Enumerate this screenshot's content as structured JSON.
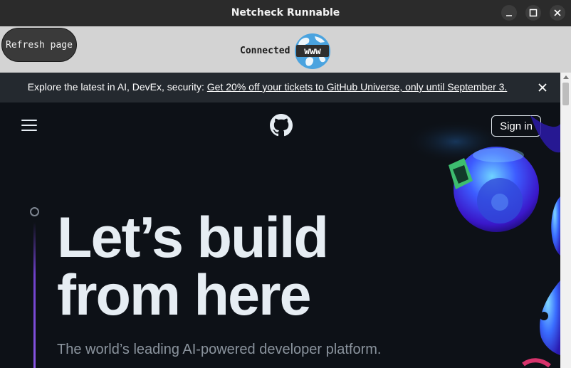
{
  "window": {
    "title": "Netcheck Runnable",
    "controls": [
      "minimize-icon",
      "maximize-icon",
      "close-icon"
    ]
  },
  "toolbar": {
    "refresh_label": "Refresh page",
    "status_text": "Connected",
    "globe_icon": "globe-www-icon",
    "globe_text": "www"
  },
  "banner": {
    "text": "Explore the latest in AI, DevEx, security: ",
    "link_text": "Get 20% off your tickets to GitHub Universe, only until September 3.",
    "close_icon": "close-icon"
  },
  "nav": {
    "menu_icon": "hamburger-menu-icon",
    "logo_icon": "github-logo-icon",
    "signin_label": "Sign in"
  },
  "hero": {
    "headline_line1": "Let’s build",
    "headline_line2": "from here",
    "subheadline": "The world’s leading AI-powered developer platform."
  },
  "colors": {
    "page_bg": "#0d1117",
    "banner_bg": "#24292f",
    "toolbar_bg": "#d3d3d3",
    "titlebar_bg": "#2b2b2b",
    "accent_purple": "#8957e5",
    "globe_blue": "#4aa3df"
  }
}
